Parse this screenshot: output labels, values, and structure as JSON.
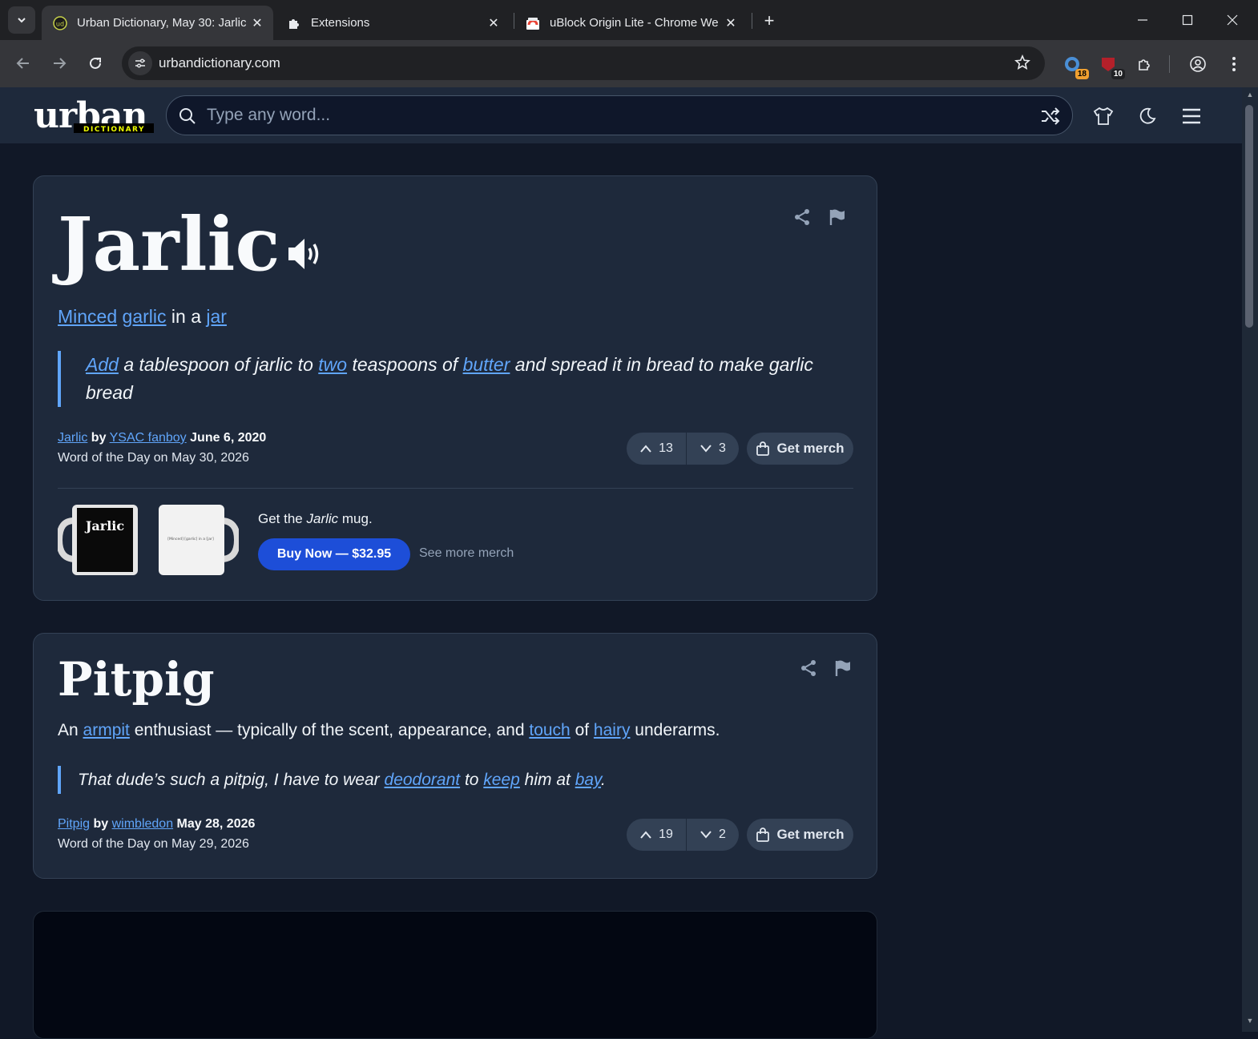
{
  "browser": {
    "tabs": [
      {
        "title": "Urban Dictionary, May 30: Jarlic",
        "active": true
      },
      {
        "title": "Extensions",
        "active": false
      },
      {
        "title": "uBlock Origin Lite - Chrome We",
        "active": false
      }
    ],
    "url": "urbandictionary.com",
    "extensions": [
      {
        "name": "ext-1",
        "badge": "18",
        "badge_color": "#f0a030"
      },
      {
        "name": "ext-2",
        "badge": "10",
        "badge_color": "#ffffff"
      }
    ]
  },
  "site": {
    "logo_main": "urban",
    "logo_sub": "DICTIONARY",
    "search_placeholder": "Type any word..."
  },
  "entries": [
    {
      "word": "Jarlic",
      "meaning": {
        "link1": "Minced",
        "link2": "garlic",
        "text1": " in a ",
        "link3": "jar"
      },
      "example": {
        "link1": "Add",
        "text1": " a tablespoon of jarlic to ",
        "link2": "two",
        "text2": " teaspoons of ",
        "link3": "butter",
        "text3": " and spread it in bread to make garlic bread"
      },
      "author_word": "Jarlic",
      "by": "by",
      "author": "YSAC fanboy",
      "date": "June 6, 2020",
      "wotd": "Word of the Day on May 30, 2026",
      "upvotes": "13",
      "downvotes": "3",
      "merch_label": "Get merch",
      "mug_text_front": "Jarlic",
      "mug_text_back": "[Minced] [garlic] in a [jar]",
      "get_mug_pre": "Get the ",
      "get_mug_word": "Jarlic",
      "get_mug_post": " mug.",
      "buy_label": "Buy Now — $32.95",
      "see_more": "See more merch"
    },
    {
      "word": "Pitpig",
      "meaning": {
        "text1": "An ",
        "link1": "armpit",
        "text2": " enthusiast — typically of the scent, appearance, and ",
        "link2": "touch",
        "text3": " of ",
        "link3": "hairy",
        "text4": " underarms."
      },
      "example": {
        "text1": "That dude’s such a pitpig, I have to wear ",
        "link1": "deodorant",
        "text2": " to ",
        "link2": "keep",
        "text3": " him at ",
        "link3": "bay",
        "text4": "."
      },
      "author_word": "Pitpig",
      "by": "by",
      "author": "wimbledon",
      "date": "May 28, 2026",
      "wotd": "Word of the Day on May 29, 2026",
      "upvotes": "19",
      "downvotes": "2",
      "merch_label": "Get merch"
    }
  ],
  "colors": {
    "link": "#60a5fa",
    "buy": "#1d4ed8",
    "card_bg": "#1e293b",
    "page_bg": "#111827"
  }
}
